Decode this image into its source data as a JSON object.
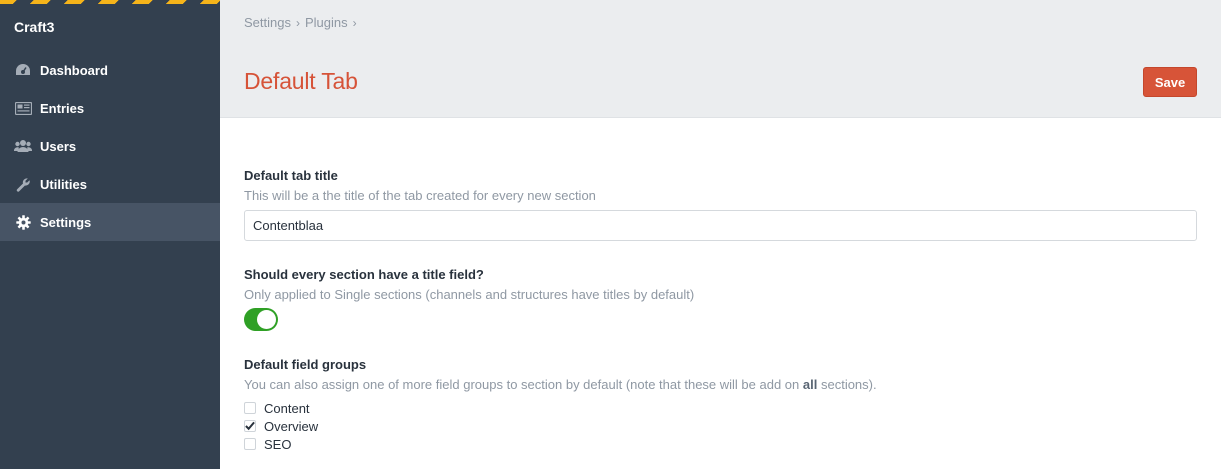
{
  "sidebar": {
    "site_name": "Craft3",
    "items": [
      {
        "label": "Dashboard",
        "icon": "dashboard-icon"
      },
      {
        "label": "Entries",
        "icon": "entries-icon"
      },
      {
        "label": "Users",
        "icon": "users-icon"
      },
      {
        "label": "Utilities",
        "icon": "wrench-icon"
      },
      {
        "label": "Settings",
        "icon": "gear-icon",
        "active": true
      }
    ]
  },
  "header": {
    "breadcrumbs": [
      "Settings",
      "Plugins"
    ],
    "separator": "›",
    "title": "Default Tab",
    "save_label": "Save"
  },
  "fields": {
    "tab_title": {
      "label": "Default tab title",
      "instructions": "This will be a the title of the tab created for every new section",
      "value": "Contentblaa"
    },
    "title_field": {
      "label": "Should every section have a title field?",
      "instructions": "Only applied to Single sections (channels and structures have titles by default)",
      "enabled": true
    },
    "field_groups": {
      "label": "Default field groups",
      "instructions_before": "You can also assign one of more field groups to section by default (note that these will be add on ",
      "instructions_bold": "all",
      "instructions_after": " sections).",
      "options": [
        {
          "label": "Content",
          "checked": false
        },
        {
          "label": "Overview",
          "checked": true
        },
        {
          "label": "SEO",
          "checked": false
        }
      ]
    }
  },
  "colors": {
    "sidebar_bg": "#33404f",
    "sidebar_active": "#475465",
    "accent_red": "#d65338",
    "toggle_on": "#2fa025",
    "stripe_yellow": "#f6b41a"
  }
}
